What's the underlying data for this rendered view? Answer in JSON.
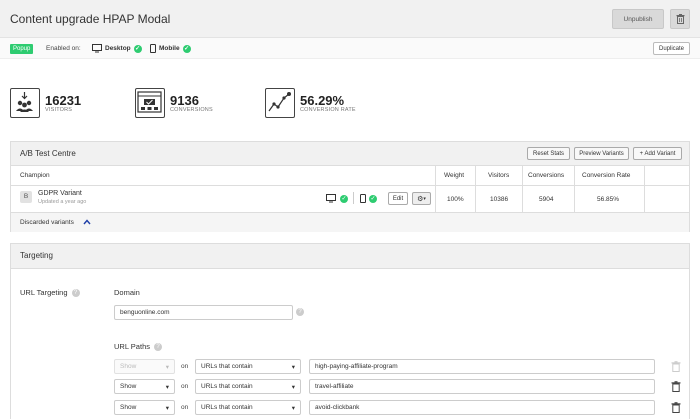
{
  "header": {
    "title": "Content upgrade HPAP Modal",
    "unpublish_label": "Unpublish"
  },
  "subbar": {
    "badge": "Popup",
    "enabled_on": "Enabled on:",
    "desktop": "Desktop",
    "mobile": "Mobile",
    "duplicate_label": "Duplicate"
  },
  "stats": [
    {
      "value": "16231",
      "label": "VISITORS"
    },
    {
      "value": "9136",
      "label": "CONVERSIONS"
    },
    {
      "value": "56.29%",
      "label": "CONVERSION RATE"
    }
  ],
  "ab_test": {
    "title": "A/B Test Centre",
    "reset_label": "Reset Stats",
    "preview_label": "Preview Variants",
    "add_label": "+ Add Variant",
    "columns": {
      "champion": "Champion",
      "weight": "Weight",
      "visitors": "Visitors",
      "conversions": "Conversions",
      "rate": "Conversion Rate"
    },
    "variant": {
      "letter": "B",
      "name": "GDPR Variant",
      "updated": "Updated a year ago",
      "edit_label": "Edit",
      "weight": "100%",
      "visitors": "10386",
      "conversions": "5904",
      "rate": "56.85%"
    },
    "discarded_label": "Discarded variants"
  },
  "targeting": {
    "title": "Targeting",
    "url_targeting_label": "URL Targeting",
    "domain_label": "Domain",
    "domain_value": "benguonline.com",
    "url_paths_label": "URL Paths",
    "on_label": "on",
    "rows": [
      {
        "mode": "Show",
        "match": "URLs that contain",
        "value": "high-paying-affiliate-program"
      },
      {
        "mode": "Show",
        "match": "URLs that contain",
        "value": "travel-affiliate"
      },
      {
        "mode": "Show",
        "match": "URLs that contain",
        "value": "avoid-clickbank"
      }
    ]
  },
  "colors": {
    "green": "#2ecc71",
    "header_bg": "#f1f1f1",
    "link_blue": "#1f3fa8"
  }
}
